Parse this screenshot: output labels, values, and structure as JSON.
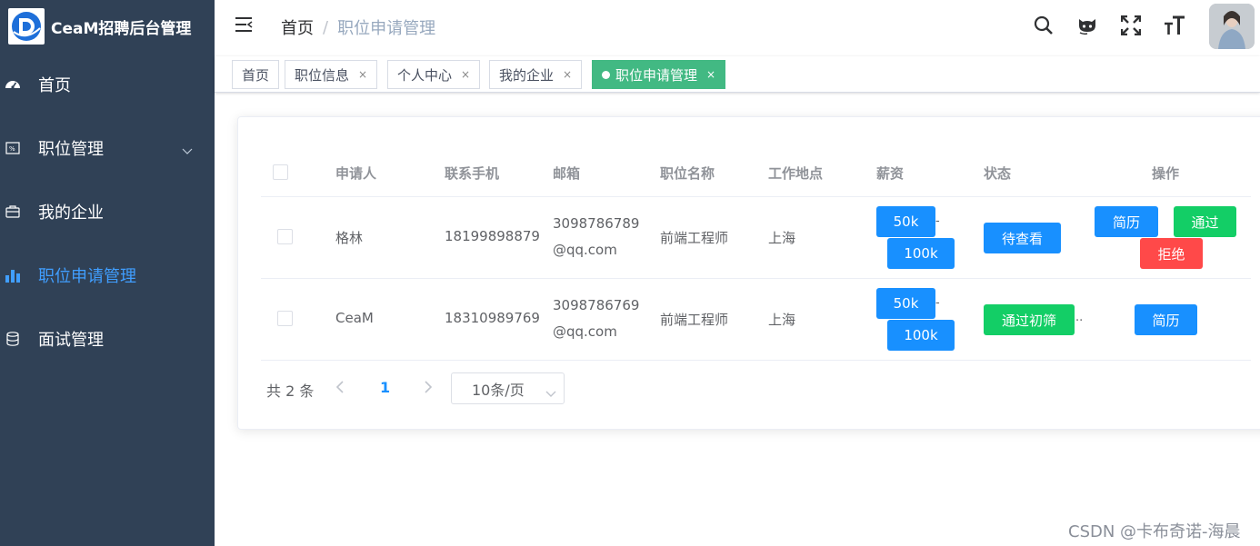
{
  "app": {
    "title": "CeaM招聘后台管理"
  },
  "sidebar": {
    "items": [
      {
        "label": "首页",
        "icon": "dashboard-icon",
        "active": false
      },
      {
        "label": "职位管理",
        "icon": "job-icon",
        "active": false,
        "expandable": true
      },
      {
        "label": "我的企业",
        "icon": "briefcase-icon",
        "active": false
      },
      {
        "label": "职位申请管理",
        "icon": "bar-chart-icon",
        "active": true
      },
      {
        "label": "面试管理",
        "icon": "database-icon",
        "active": false
      }
    ]
  },
  "navbar": {
    "breadcrumb": [
      "首页",
      "职位申请管理"
    ],
    "separator": "/",
    "icons": [
      "search-icon",
      "github-icon",
      "fullscreen-icon",
      "font-size-icon"
    ]
  },
  "tags": [
    {
      "label": "首页",
      "closable": false,
      "active": false
    },
    {
      "label": "职位信息",
      "closable": true,
      "active": false
    },
    {
      "label": "个人中心",
      "closable": true,
      "active": false
    },
    {
      "label": "我的企业",
      "closable": true,
      "active": false
    },
    {
      "label": "职位申请管理",
      "closable": true,
      "active": true
    }
  ],
  "tag_close_glyph": "×",
  "table": {
    "headers": [
      "申请人",
      "联系手机",
      "邮箱",
      "职位名称",
      "工作地点",
      "薪资",
      "状态",
      "操作"
    ],
    "rows": [
      {
        "name": "格林",
        "phone": "18199898879",
        "email_line1": "3098786789",
        "email_line2": "@qq.com",
        "position": "前端工程师",
        "location": "上海",
        "salary_min": "50k",
        "salary_max": "100k",
        "salary_sep": "-",
        "status": "待查看",
        "status_color": "#1890ff",
        "status_suffix": "",
        "actions": [
          "简历",
          "通过",
          "拒绝"
        ]
      },
      {
        "name": "CeaM",
        "phone": "18310989769",
        "email_line1": "3098786769",
        "email_line2": "@qq.com",
        "position": "前端工程师",
        "location": "上海",
        "salary_min": "50k",
        "salary_max": "100k",
        "salary_sep": "-",
        "status": "通过初筛",
        "status_color": "#13ce66",
        "status_suffix": "..",
        "actions": [
          "简历"
        ]
      }
    ]
  },
  "pagination": {
    "total_text": "共 2 条",
    "current_page": "1",
    "page_size": "10条/页",
    "prev": "‹",
    "next": "›"
  },
  "watermark": "CSDN @卡布奇诺-海晨",
  "colors": {
    "sidebar_bg": "#304156",
    "active": "#409eff",
    "primary": "#1890ff",
    "success": "#13ce66",
    "danger": "#ff4949",
    "tag_active": "#42b983"
  }
}
